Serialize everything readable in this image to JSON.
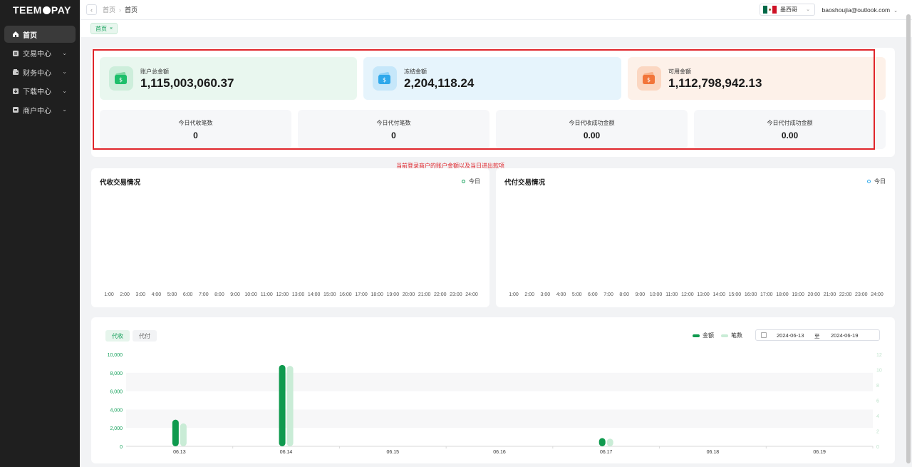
{
  "brand": {
    "logo_left": "TEEM",
    "logo_right": "PAY"
  },
  "sidebar": {
    "items": [
      {
        "label": "首页",
        "icon": "home-icon",
        "active": true
      },
      {
        "label": "交易中心",
        "icon": "trade-icon",
        "active": false
      },
      {
        "label": "财务中心",
        "icon": "wallet-icon",
        "active": false
      },
      {
        "label": "下载中心",
        "icon": "download-icon",
        "active": false
      },
      {
        "label": "商户中心",
        "icon": "merchant-icon",
        "active": false
      }
    ]
  },
  "topbar": {
    "breadcrumb_root": "首页",
    "breadcrumb_current": "首页",
    "language": "墨西哥",
    "user_email": "baoshoujia@outlook.com"
  },
  "tags": {
    "home": "首页"
  },
  "summary": {
    "total_label": "账户总金额",
    "total_value": "1,115,003,060.37",
    "frozen_label": "冻结金额",
    "frozen_value": "2,204,118.24",
    "available_label": "可用金额",
    "available_value": "1,112,798,942.13",
    "today_collect_count_label": "今日代收笔数",
    "today_collect_count": "0",
    "today_pay_count_label": "今日代付笔数",
    "today_pay_count": "0",
    "today_collect_amount_label": "今日代收成功金额",
    "today_collect_amount": "0.00",
    "today_pay_amount_label": "今日代付成功金额",
    "today_pay_amount": "0.00"
  },
  "annotation": "当前登录商户的账户金额以及当日进出款项",
  "collect_chart": {
    "title": "代收交易情况",
    "legend": "今日"
  },
  "pay_chart": {
    "title": "代付交易情况",
    "legend": "今日"
  },
  "hours": [
    "1:00",
    "2:00",
    "3:00",
    "4:00",
    "5:00",
    "6:00",
    "7:00",
    "8:00",
    "9:00",
    "10:00",
    "11:00",
    "12:00",
    "13:00",
    "14:00",
    "15:00",
    "16:00",
    "17:00",
    "18:00",
    "19:00",
    "20:00",
    "21:00",
    "22:00",
    "23:00",
    "24:00"
  ],
  "bar_section": {
    "tab_collect": "代收",
    "tab_pay": "代付",
    "date_start": "2024-06-13",
    "date_sep": "至",
    "date_end": "2024-06-19"
  },
  "colors": {
    "amount": "#0f9a4e",
    "count": "#c9ecd6",
    "accent": "#14a05a",
    "highlight": "#e0252b"
  },
  "chart_data": {
    "type": "bar",
    "categories": [
      "06.13",
      "06.14",
      "06.15",
      "06.16",
      "06.17",
      "06.18",
      "06.19"
    ],
    "series": [
      {
        "name": "金额",
        "axis": "left",
        "values": [
          2900,
          8850,
          0,
          0,
          900,
          0,
          0
        ]
      },
      {
        "name": "笔数",
        "axis": "right",
        "values": [
          3,
          10.5,
          0,
          0,
          1,
          0,
          0
        ]
      }
    ],
    "y_left": {
      "ticks": [
        "0",
        "2,000",
        "4,000",
        "6,000",
        "8,000",
        "10,000"
      ],
      "max": 10000
    },
    "y_right": {
      "ticks": [
        "0",
        "2",
        "4",
        "6",
        "8",
        "10",
        "12"
      ],
      "max": 12
    },
    "legend_position": "top-right",
    "grid": "horizontal bands"
  }
}
